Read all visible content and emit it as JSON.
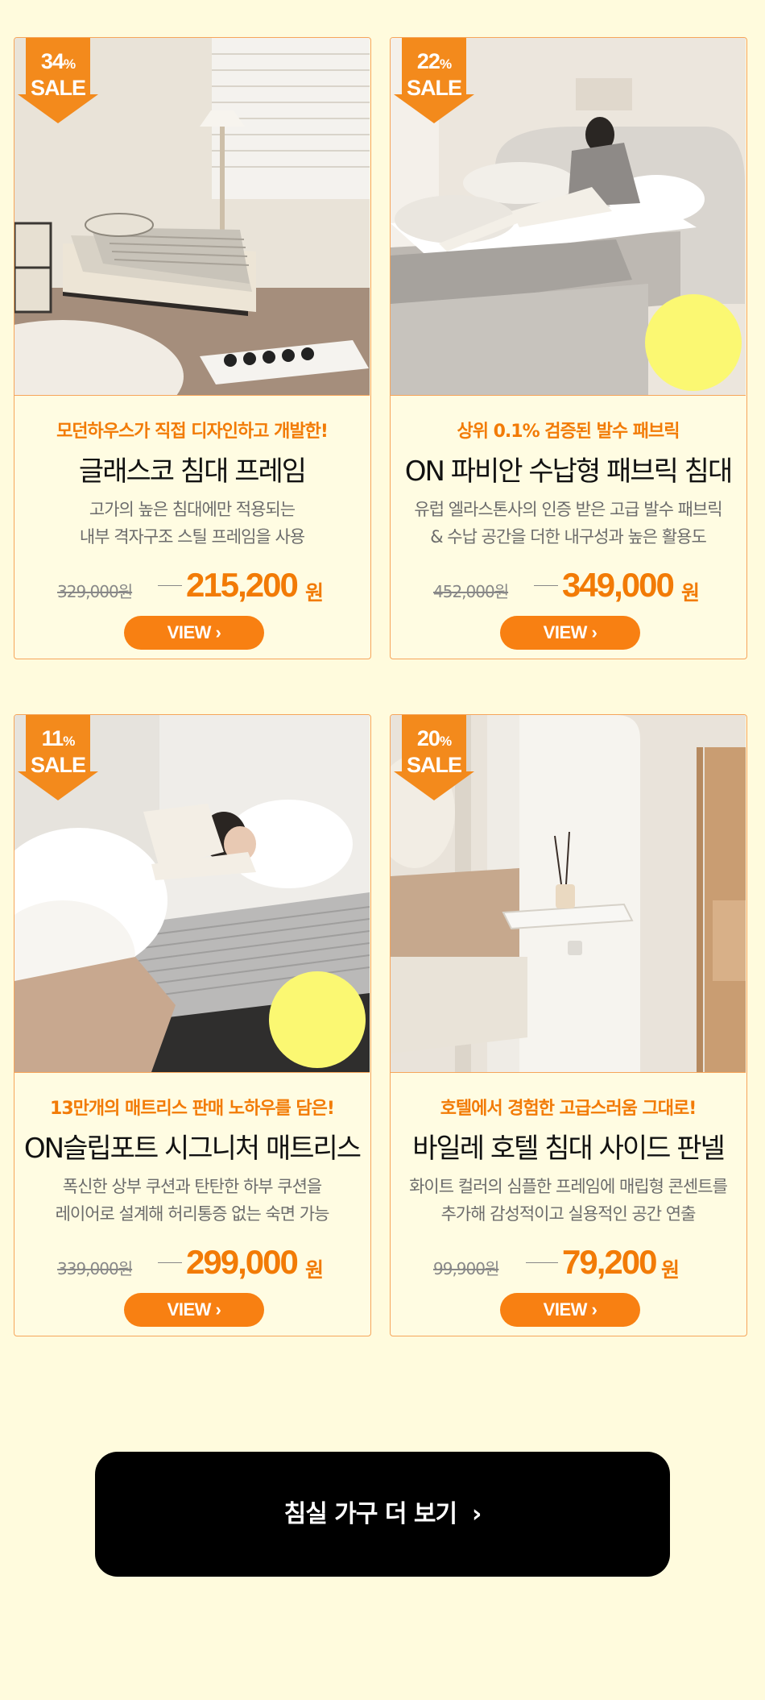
{
  "products": [
    {
      "discount": "34",
      "pct_unit": "%",
      "sale_label": "SALE",
      "tagline": "모던하우스가 직접 디자인하고 개발한!",
      "title": "글래스코 침대 프레임",
      "desc_line1": "고가의 높은 침대에만 적용되는",
      "desc_line2": "내부 격자구조 스틸 프레임을 사용",
      "original_price": "329,000원",
      "sale_price": "215,200",
      "currency": "원",
      "view_label": "VIEW"
    },
    {
      "discount": "22",
      "pct_unit": "%",
      "sale_label": "SALE",
      "tagline": "상위 0.1% 검증된 발수 패브릭",
      "title": "ON 파비안 수납형 패브릭 침대",
      "desc_line1": "유럽 엘라스톤사의 인증 받은 고급 발수 패브릭",
      "desc_line2": "& 수납 공간을 더한 내구성과 높은 활용도",
      "original_price": "452,000원",
      "sale_price": "349,000",
      "currency": "원",
      "view_label": "VIEW"
    },
    {
      "discount": "11",
      "pct_unit": "%",
      "sale_label": "SALE",
      "tagline": "13만개의 매트리스 판매 노하우를 담은!",
      "title": "ON슬립포트 시그니처 매트리스",
      "desc_line1": "폭신한 상부 쿠션과 탄탄한 하부 쿠션을",
      "desc_line2": "레이어로 설계해 허리통증 없는 숙면 가능",
      "original_price": "339,000원",
      "sale_price": "299,000",
      "currency": "원",
      "view_label": "VIEW"
    },
    {
      "discount": "20",
      "pct_unit": "%",
      "sale_label": "SALE",
      "tagline": "호텔에서 경험한 고급스러움 그대로!",
      "title": "바일레 호텔 침대 사이드 판넬",
      "desc_line1": "화이트 컬러의 심플한 프레임에 매립형 콘센트를",
      "desc_line2": "추가해 감성적이고 실용적인 공간 연출",
      "original_price": "99,900원",
      "sale_price": "79,200",
      "currency": "원",
      "view_label": "VIEW"
    }
  ],
  "more_button": {
    "label": "침실 가구 더 보기"
  },
  "colors": {
    "page_bg": "#fffbdd",
    "accent": "#f88012",
    "card_border": "#f6a55b",
    "highlight_dot": "#fbf872"
  }
}
